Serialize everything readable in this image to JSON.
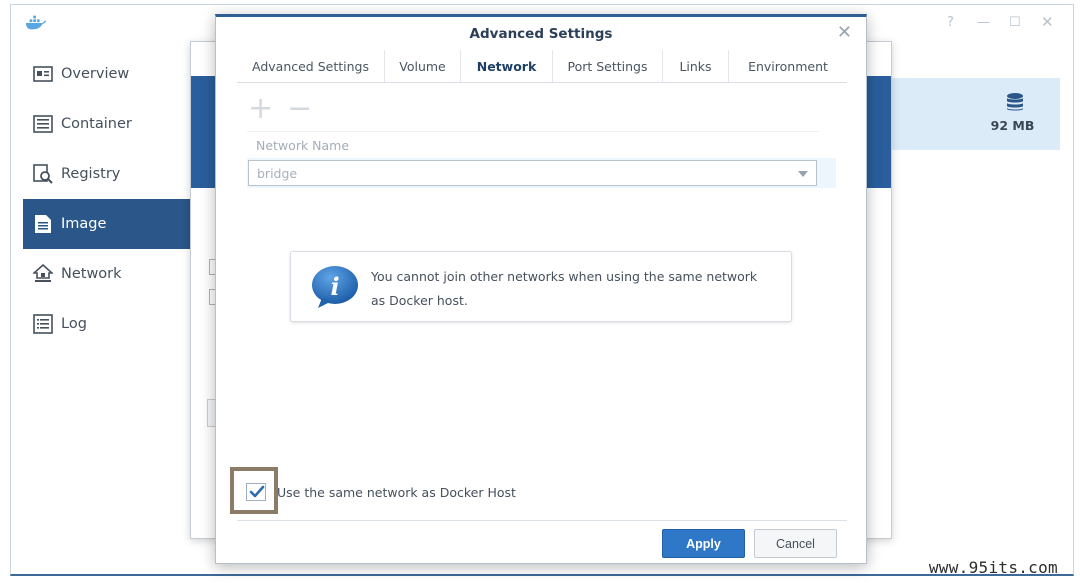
{
  "app": {
    "sidebar": [
      {
        "label": "Overview",
        "icon": "overview-icon"
      },
      {
        "label": "Container",
        "icon": "container-icon"
      },
      {
        "label": "Registry",
        "icon": "registry-icon"
      },
      {
        "label": "Image",
        "icon": "image-icon",
        "active": true
      },
      {
        "label": "Network",
        "icon": "network-icon"
      },
      {
        "label": "Log",
        "icon": "log-icon"
      }
    ],
    "storage_size": "92 MB"
  },
  "dialog": {
    "title": "Advanced Settings",
    "tabs": [
      "Advanced Settings",
      "Volume",
      "Network",
      "Port Settings",
      "Links",
      "Environment"
    ],
    "active_tab": "Network",
    "network_name_header": "Network Name",
    "network_value": "bridge",
    "notice_text": "You cannot join other networks when using the same network as Docker host.",
    "checkbox_label": "Use the same network as Docker Host",
    "checkbox_checked": true,
    "apply_label": "Apply",
    "cancel_label": "Cancel"
  },
  "watermark": "www.95its.com",
  "colors": {
    "accent": "#2a5689",
    "apply": "#2f78c8",
    "highlight_box": "#8b7b67"
  }
}
